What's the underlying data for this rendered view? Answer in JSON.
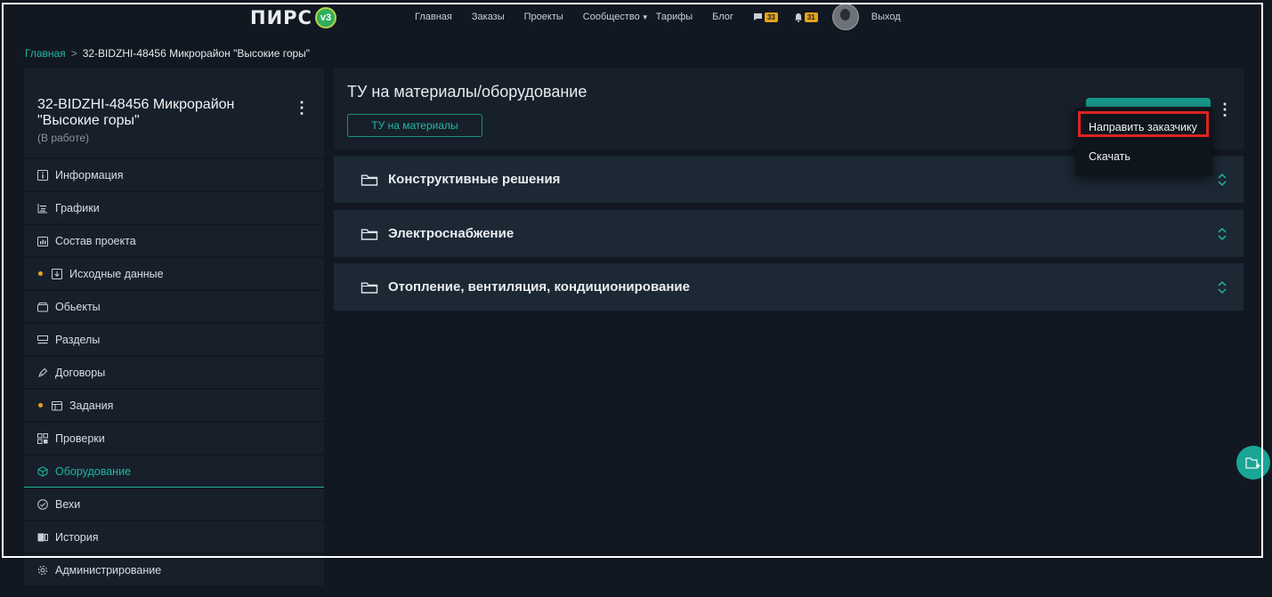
{
  "header": {
    "logo_text": "ПИРС",
    "logo_badge": "v3",
    "nav": {
      "home": "Главная",
      "orders": "Заказы",
      "projects": "Проекты",
      "community": "Сообщество",
      "tariffs": "Тарифы",
      "blog": "Блог",
      "messages_count": "33",
      "notifications_count": "31",
      "logout": "Выход"
    }
  },
  "breadcrumb": {
    "home": "Главная",
    "separator": ">",
    "current": "32-BIDZHI-48456 Микрорайон \"Высокие горы\""
  },
  "project": {
    "title": "32-BIDZHI-48456 Микрорайон \"Высокие горы\"",
    "status": "(В работе)"
  },
  "sidebar": {
    "items": [
      {
        "label": "Информация",
        "icon": "info-icon"
      },
      {
        "label": "Графики",
        "icon": "chart-icon"
      },
      {
        "label": "Состав проекта",
        "icon": "composition-icon"
      },
      {
        "label": "Исходные данные",
        "icon": "download-icon",
        "dot": true
      },
      {
        "label": "Обьекты",
        "icon": "box-icon"
      },
      {
        "label": "Разделы",
        "icon": "sections-icon"
      },
      {
        "label": "Договоры",
        "icon": "pen-icon"
      },
      {
        "label": "Задания",
        "icon": "tasks-icon",
        "dot": true
      },
      {
        "label": "Проверки",
        "icon": "checks-icon"
      },
      {
        "label": "Оборудование",
        "icon": "cube-icon",
        "active": true
      },
      {
        "label": "Вехи",
        "icon": "check-circle-icon"
      },
      {
        "label": "История",
        "icon": "history-icon"
      },
      {
        "label": "Администрирование",
        "icon": "gear-icon"
      }
    ]
  },
  "main": {
    "title": "ТУ на материалы/оборудование",
    "tag_button": "ТУ на материалы",
    "dropdown": {
      "send_to_customer": "Направить заказчику",
      "download": "Скачать"
    },
    "sections": [
      {
        "label": "Конструктивные решения"
      },
      {
        "label": "Электроснабжение"
      },
      {
        "label": "Отопление, вентиляция, кондиционирование"
      }
    ]
  },
  "colors": {
    "background": "#121821",
    "panel": "#17202a",
    "accordion": "#1c2834",
    "accent": "#1fb6a3",
    "badge": "#e7a21a",
    "highlight": "#e02222"
  }
}
